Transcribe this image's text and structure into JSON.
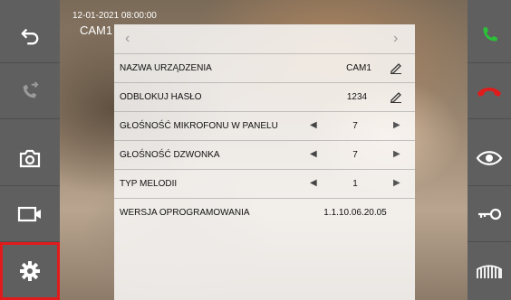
{
  "overlay": {
    "datetime": "12-01-2021  08:00:00",
    "camera": "CAM1"
  },
  "sidebar_left": {
    "items": [
      {
        "name": "back-icon"
      },
      {
        "name": "call-transfer-icon"
      },
      {
        "name": "camera-snapshot-icon"
      },
      {
        "name": "video-record-icon"
      },
      {
        "name": "settings-gear-icon",
        "selected": true
      }
    ]
  },
  "sidebar_right": {
    "items": [
      {
        "name": "answer-call-icon",
        "color": "#2bbf3a"
      },
      {
        "name": "hang-up-icon",
        "color": "#e11b1b"
      },
      {
        "name": "monitor-eye-icon"
      },
      {
        "name": "unlock-key-icon"
      },
      {
        "name": "gate-icon"
      }
    ]
  },
  "settings": {
    "rows": [
      {
        "label": "NAZWA URZĄDZENIA",
        "value": "CAM1",
        "type": "edit"
      },
      {
        "label": "ODBLOKUJ HASŁO",
        "value": "1234",
        "type": "edit"
      },
      {
        "label": "GŁOŚNOŚĆ MIKROFONU W PANELU",
        "value": "7",
        "type": "stepper"
      },
      {
        "label": "GŁOŚNOŚĆ DZWONKA",
        "value": "7",
        "type": "stepper"
      },
      {
        "label": "TYP MELODII",
        "value": "1",
        "type": "stepper"
      },
      {
        "label": "WERSJA OPROGRAMOWANIA",
        "value": "1.1.10.06.20.05",
        "type": "readonly"
      }
    ]
  },
  "colors": {
    "active_outline": "#e11b1b",
    "sidebar_bg": "#5f5f5f"
  }
}
